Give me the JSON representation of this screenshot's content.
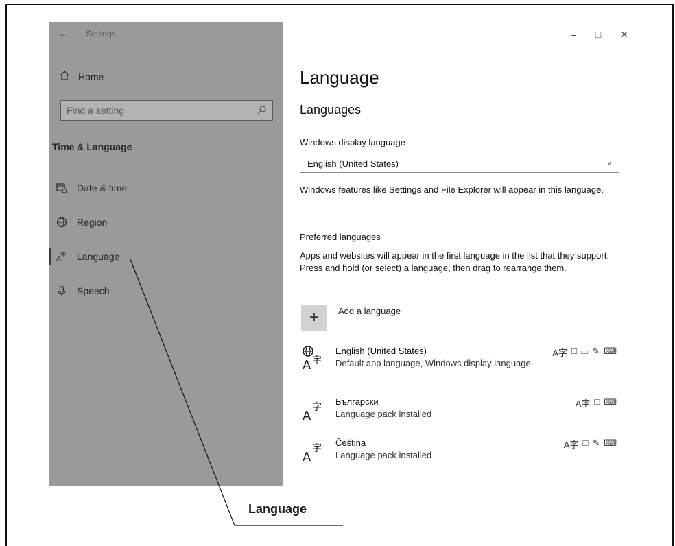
{
  "window": {
    "title": "Settings"
  },
  "sidebar": {
    "home_label": "Home",
    "search_placeholder": "Find a setting",
    "section_title": "Time & Language",
    "items": [
      {
        "label": "Date & time",
        "icon": "calendar-clock-icon"
      },
      {
        "label": "Region",
        "icon": "globe-icon"
      },
      {
        "label": "Language",
        "icon": "language-icon",
        "selected": true
      },
      {
        "label": "Speech",
        "icon": "microphone-icon"
      }
    ]
  },
  "main": {
    "page_title": "Language",
    "section_title": "Languages",
    "display_language_label": "Windows display language",
    "display_language_value": "English (United States)",
    "display_language_desc": "Windows features like Settings and File Explorer will appear in this language.",
    "preferred_title": "Preferred languages",
    "preferred_desc": "Apps and websites will appear in the first language in the list that they support. Press and hold (or select) a language, then drag to rearrange them.",
    "add_language_label": "Add a language",
    "languages": [
      {
        "name": "English (United States)",
        "status": "Default app language, Windows display language"
      },
      {
        "name": "Български",
        "status": "Language pack installed"
      },
      {
        "name": "Čeština",
        "status": "Language pack installed"
      }
    ]
  },
  "callout": {
    "label": "Language"
  }
}
